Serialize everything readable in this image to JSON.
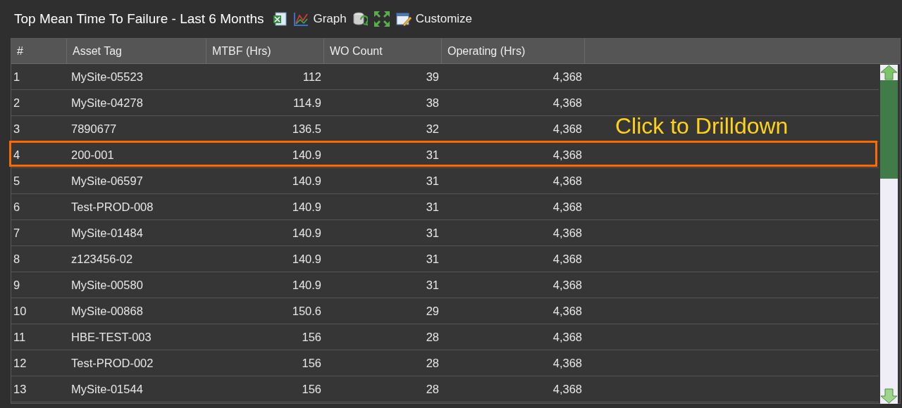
{
  "title": "Top Mean Time To Failure - Last 6 Months",
  "toolbar": [
    {
      "kind": "excel"
    },
    {
      "kind": "graph",
      "label": "Graph"
    },
    {
      "kind": "refresh"
    },
    {
      "kind": "expand"
    },
    {
      "kind": "customize",
      "label": "Customize"
    }
  ],
  "table": {
    "columns": [
      "#",
      "Asset Tag",
      "MTBF (Hrs)",
      "WO Count",
      "Operating (Hrs)"
    ],
    "rows": [
      {
        "cells": [
          "1",
          "MySite-05523",
          "112",
          "39",
          "4,368"
        ],
        "selected": false
      },
      {
        "cells": [
          "2",
          "MySite-04278",
          "114.9",
          "38",
          "4,368"
        ],
        "selected": false
      },
      {
        "cells": [
          "3",
          "7890677",
          "136.5",
          "32",
          "4,368"
        ],
        "selected": false
      },
      {
        "cells": [
          "4",
          "200-001",
          "140.9",
          "31",
          "4,368"
        ],
        "selected": true
      },
      {
        "cells": [
          "5",
          "MySite-06597",
          "140.9",
          "31",
          "4,368"
        ],
        "selected": false
      },
      {
        "cells": [
          "6",
          "Test-PROD-008",
          "140.9",
          "31",
          "4,368"
        ],
        "selected": false
      },
      {
        "cells": [
          "7",
          "MySite-01484",
          "140.9",
          "31",
          "4,368"
        ],
        "selected": false
      },
      {
        "cells": [
          "8",
          "z123456-02",
          "140.9",
          "31",
          "4,368"
        ],
        "selected": false
      },
      {
        "cells": [
          "9",
          "MySite-00580",
          "140.9",
          "31",
          "4,368"
        ],
        "selected": false
      },
      {
        "cells": [
          "10",
          "MySite-00868",
          "150.6",
          "29",
          "4,368"
        ],
        "selected": false
      },
      {
        "cells": [
          "11",
          "HBE-TEST-003",
          "156",
          "28",
          "4,368"
        ],
        "selected": false
      },
      {
        "cells": [
          "12",
          "Test-PROD-002",
          "156",
          "28",
          "4,368"
        ],
        "selected": false
      },
      {
        "cells": [
          "13",
          "MySite-01544",
          "156",
          "28",
          "4,368"
        ],
        "selected": false
      }
    ]
  },
  "callout": "Click to Drilldown"
}
